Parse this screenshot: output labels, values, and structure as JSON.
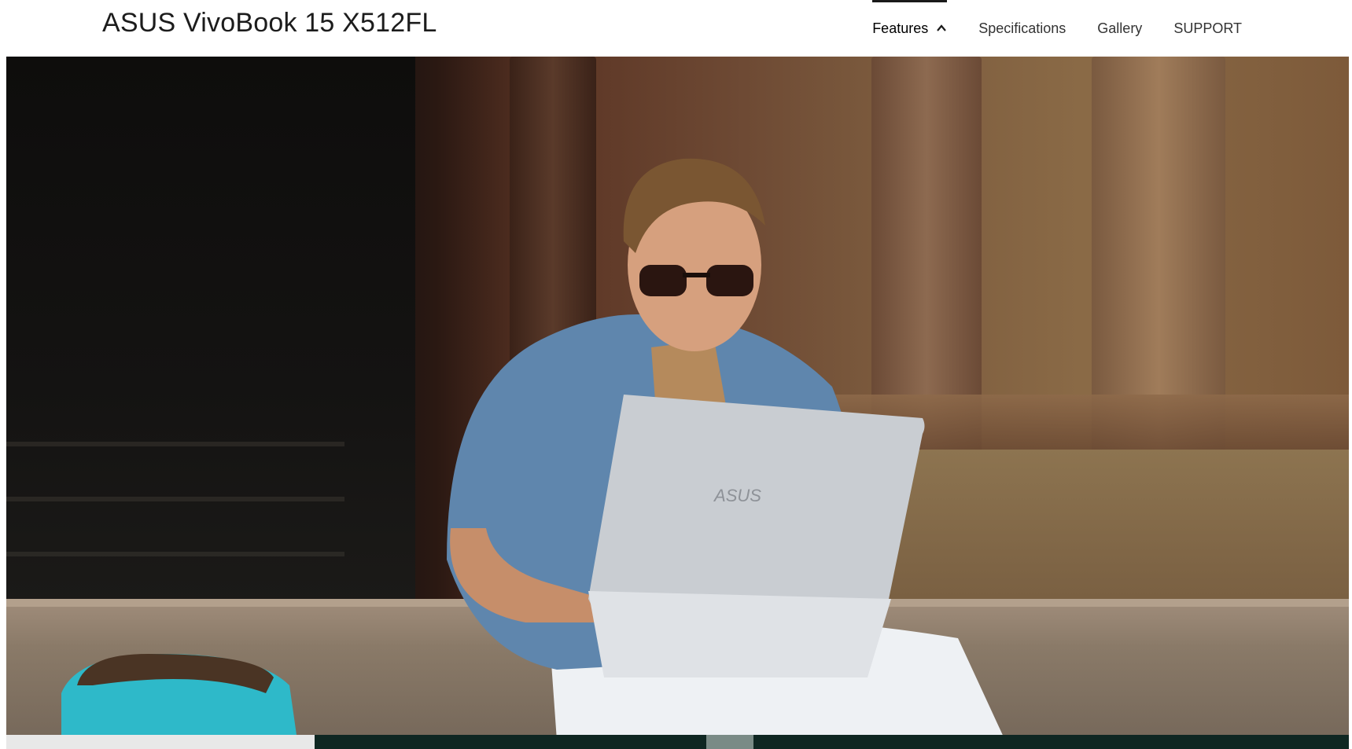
{
  "header": {
    "product_title": "ASUS VivoBook 15 X512FL",
    "nav": [
      {
        "label": "Features",
        "active": true,
        "icon": "chevron-up-icon"
      },
      {
        "label": "Specifications",
        "active": false
      },
      {
        "label": "Gallery",
        "active": false
      },
      {
        "label": "SUPPORT",
        "active": false
      }
    ]
  },
  "hero": {
    "laptop_logo": "ASUS"
  },
  "colors": {
    "nav_active_bar": "#1a1a1a",
    "hero_bottom_bar": "#0f2722"
  }
}
